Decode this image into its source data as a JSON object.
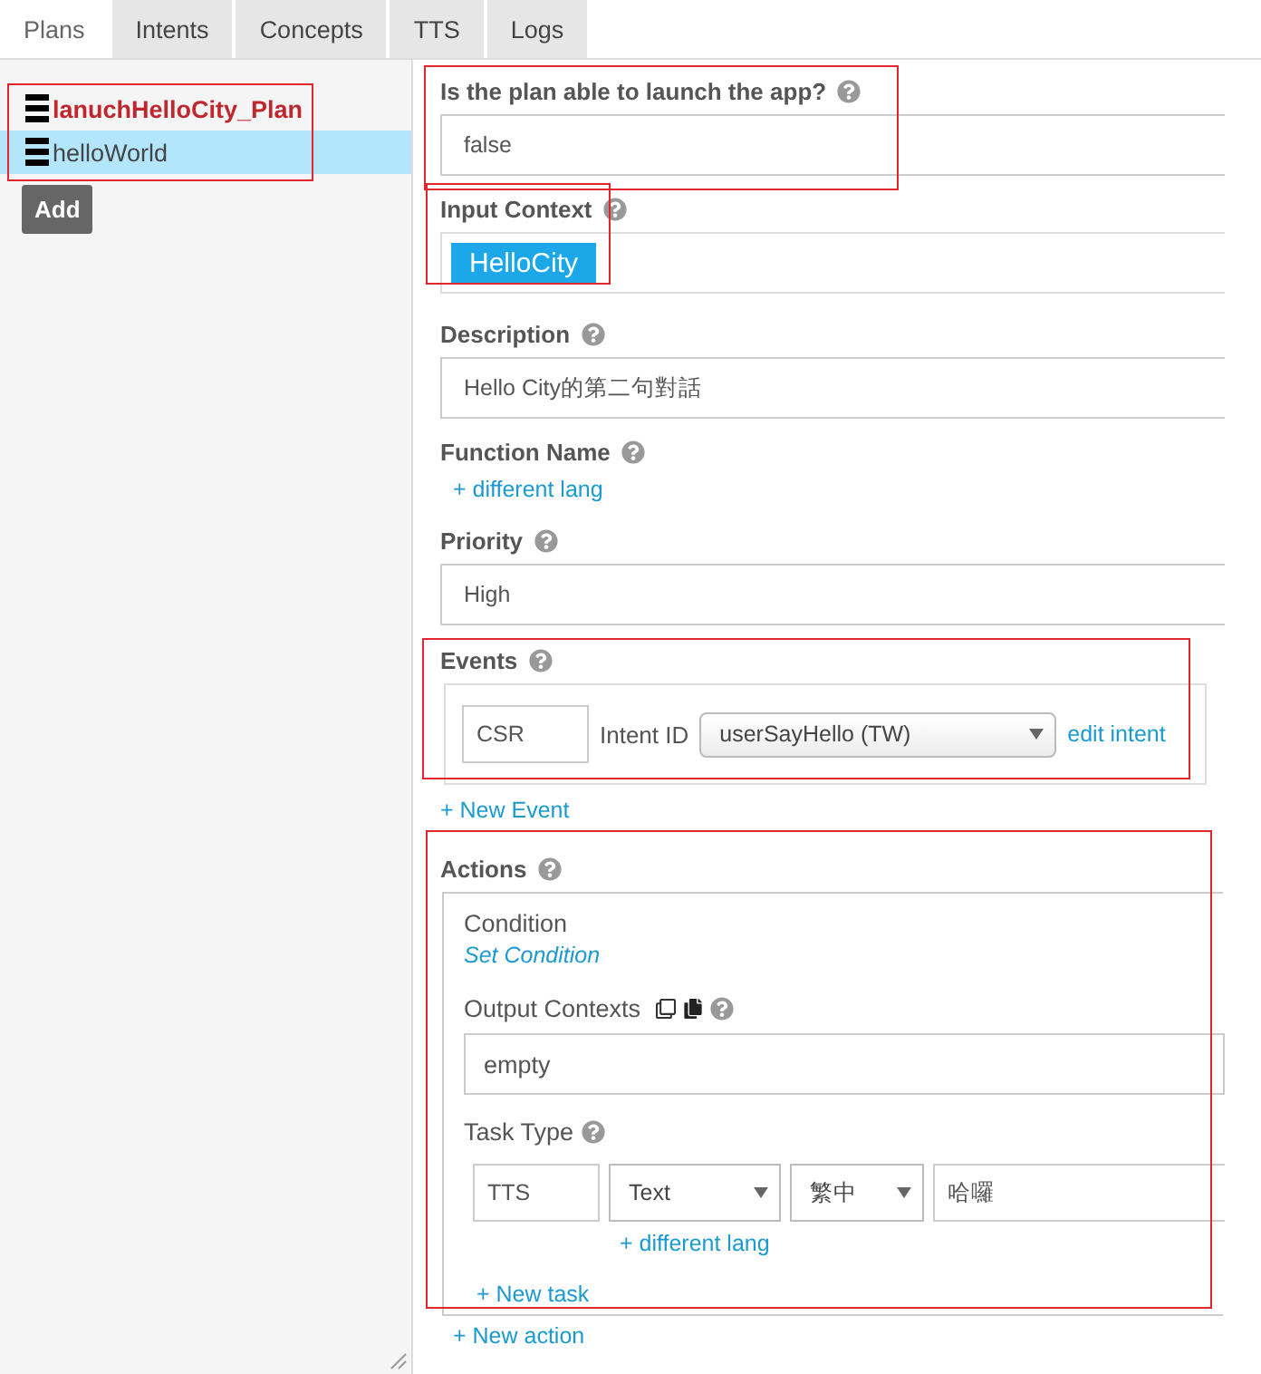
{
  "tabs": [
    {
      "label": "Plans",
      "selected": true
    },
    {
      "label": "Intents",
      "selected": false
    },
    {
      "label": "Concepts",
      "selected": false
    },
    {
      "label": "TTS",
      "selected": false
    },
    {
      "label": "Logs",
      "selected": false
    }
  ],
  "plans": {
    "annotated": true,
    "items": [
      {
        "label": "lanuchHelloCity_Plan",
        "current": true,
        "selected": false
      },
      {
        "label": "helloWorld",
        "current": false,
        "selected": true
      }
    ],
    "add_button": "Add"
  },
  "form": {
    "launch": {
      "label": "Is the plan able to launch the app?",
      "value": "false",
      "annotated": true
    },
    "input_context": {
      "label": "Input Context",
      "chips": [
        "HelloCity"
      ],
      "annotated": true
    },
    "description": {
      "label": "Description",
      "value": "Hello City的第二句對話"
    },
    "function_name": {
      "label": "Function Name",
      "link": "+ different lang"
    },
    "priority": {
      "label": "Priority",
      "value": "High"
    },
    "events": {
      "label": "Events",
      "annotated": true,
      "rows": [
        {
          "code": "CSR",
          "intent_label": "Intent ID",
          "intent": "userSayHello (TW)",
          "edit_link": "edit intent"
        }
      ],
      "new_link": "+ New Event"
    },
    "actions": {
      "label": "Actions",
      "annotated": true,
      "items": [
        {
          "condition_label": "Condition",
          "condition_link": "Set Condition",
          "output_label": "Output Contexts",
          "output_value": "empty",
          "task_label": "Task Type",
          "tasks": [
            {
              "code": "TTS",
              "type": "Text",
              "lang": "繁中",
              "text": "哈囉",
              "lang_link": "+ different lang"
            }
          ],
          "new_task": "+ New task"
        }
      ],
      "new_action": "+ New action"
    }
  }
}
